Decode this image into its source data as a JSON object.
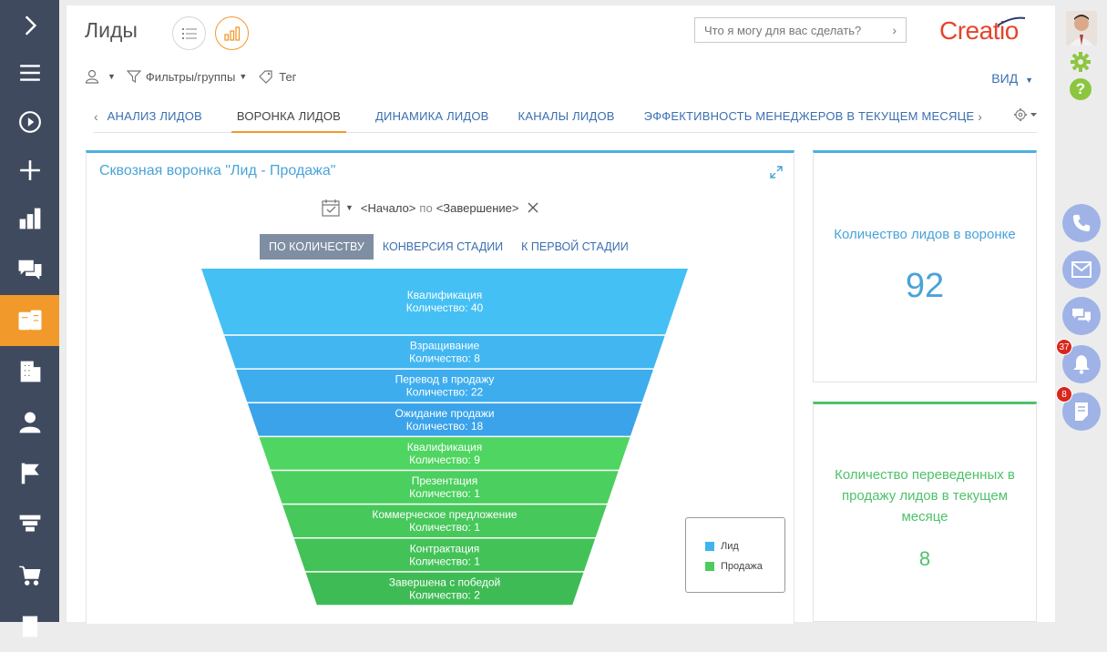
{
  "header": {
    "title": "Лиды",
    "search_placeholder": "Что я могу для вас сделать?",
    "logo": "Creatio"
  },
  "toolbar": {
    "filters_label": "Фильтры/группы",
    "tag_label": "Тег",
    "view_label": "ВИД"
  },
  "tabs": [
    {
      "label": "АНАЛИЗ ЛИДОВ",
      "active": false
    },
    {
      "label": "ВОРОНКА ЛИДОВ",
      "active": true
    },
    {
      "label": "ДИНАМИКА ЛИДОВ",
      "active": false
    },
    {
      "label": "КАНАЛЫ ЛИДОВ",
      "active": false
    },
    {
      "label": "ЭФФЕКТИВНОСТЬ МЕНЕДЖЕРОВ В ТЕКУЩЕМ МЕСЯЦЕ",
      "active": false
    }
  ],
  "funnel_panel": {
    "title": "Сквозная воронка \"Лид - Продажа\"",
    "period_start": "<Начало>",
    "period_sep": "по",
    "period_end": "<Завершение>",
    "modes": [
      {
        "label": "ПО КОЛИЧЕСТВУ",
        "selected": true
      },
      {
        "label": "КОНВЕРСИЯ СТАДИИ",
        "selected": false
      },
      {
        "label": "К ПЕРВОЙ СТАДИИ",
        "selected": false
      }
    ]
  },
  "chart_data": {
    "type": "funnel",
    "count_prefix": "Количество: ",
    "stages": [
      {
        "name": "Квалификация",
        "value": 40,
        "series": "Лид"
      },
      {
        "name": "Взращивание",
        "value": 8,
        "series": "Лид"
      },
      {
        "name": "Перевод в продажу",
        "value": 22,
        "series": "Лид"
      },
      {
        "name": "Ожидание продажи",
        "value": 18,
        "series": "Лид"
      },
      {
        "name": "Квалификация",
        "value": 9,
        "series": "Продажа"
      },
      {
        "name": "Презентация",
        "value": 1,
        "series": "Продажа"
      },
      {
        "name": "Коммерческое предложение",
        "value": 1,
        "series": "Продажа"
      },
      {
        "name": "Контрактация",
        "value": 1,
        "series": "Продажа"
      },
      {
        "name": "Завершена с победой",
        "value": 2,
        "series": "Продажа"
      }
    ],
    "legend": [
      {
        "name": "Лид",
        "color": "#3fb4ee"
      },
      {
        "name": "Продажа",
        "color": "#4ccc5c"
      }
    ],
    "legend_position": "bottom-right"
  },
  "kpis": {
    "leads_in_funnel_label": "Количество лидов в воронке",
    "leads_in_funnel_value": "92",
    "converted_label": "Количество переведенных в продажу лидов в текущем месяце",
    "converted_value": "8"
  },
  "right_rail": {
    "notifications_badge": "37",
    "tasks_badge": "8"
  },
  "colors": {
    "accent": "#f19a2b",
    "nav_bg": "#3f4a5f",
    "link": "#3b6fb0",
    "lead": "#3fb4ee",
    "sale": "#4ccc5c"
  }
}
